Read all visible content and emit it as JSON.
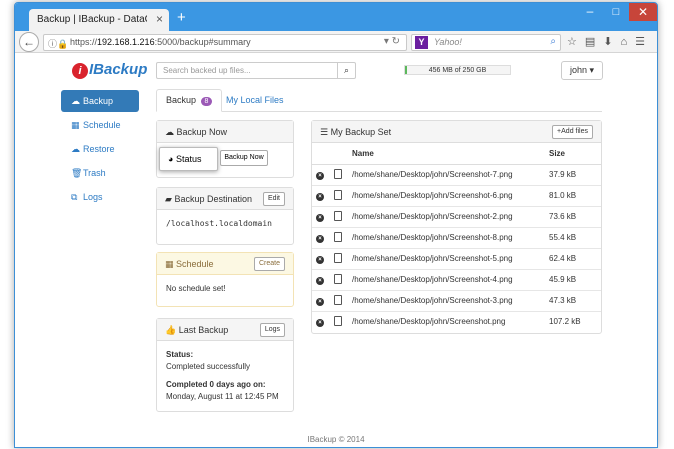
{
  "browser": {
    "tab_title": "Backup | IBackup - DataCenter ...",
    "tab_close": "×",
    "new_tab": "+",
    "url_prefix": "https://",
    "url_host": "192.168.1.216",
    "url_rest": ":5000/backup#summary",
    "search_placeholder": "Yahoo!",
    "window_buttons": {
      "minimize": "–",
      "maximize": "□",
      "close": "✕"
    }
  },
  "app": {
    "logo": "IBackup",
    "search_placeholder": "Search backed up files...",
    "storage": {
      "label": "456 MB of 250 GB",
      "used_fraction": 0.002
    },
    "user": "john"
  },
  "sidebar": {
    "items": [
      {
        "label": "Backup",
        "icon": "cloud-upload-icon",
        "active": true
      },
      {
        "label": "Schedule",
        "icon": "calendar-icon"
      },
      {
        "label": "Restore",
        "icon": "cloud-download-icon"
      },
      {
        "label": "Trash",
        "icon": "trash-icon"
      },
      {
        "label": "Logs",
        "icon": "logs-icon"
      }
    ]
  },
  "tabs": {
    "backup": "Backup",
    "backup_count": "8",
    "local_files": "My Local Files"
  },
  "backup_now": {
    "title": "Backup Now",
    "status_label": "Status",
    "button": "Backup Now"
  },
  "destination": {
    "title": "Backup Destination",
    "edit": "Edit",
    "value": "/localhost.localdomain"
  },
  "schedule": {
    "title": "Schedule",
    "create": "Create",
    "empty": "No schedule set!"
  },
  "last_backup": {
    "title": "Last Backup",
    "logs": "Logs",
    "status_label": "Status:",
    "status_value": "Completed successfully",
    "completed_label": "Completed 0 days ago on:",
    "completed_value": "Monday, August 11 at 12:45 PM"
  },
  "backup_set": {
    "title": "My Backup Set",
    "add_files": "Add files",
    "col_name": "Name",
    "col_size": "Size",
    "files": [
      {
        "name": "/home/shane/Desktop/john/Screenshot-7.png",
        "size": "37.9 kB"
      },
      {
        "name": "/home/shane/Desktop/john/Screenshot-6.png",
        "size": "81.0 kB"
      },
      {
        "name": "/home/shane/Desktop/john/Screenshot-2.png",
        "size": "73.6 kB"
      },
      {
        "name": "/home/shane/Desktop/john/Screenshot-8.png",
        "size": "55.4 kB"
      },
      {
        "name": "/home/shane/Desktop/john/Screenshot-5.png",
        "size": "62.4 kB"
      },
      {
        "name": "/home/shane/Desktop/john/Screenshot-4.png",
        "size": "45.9 kB"
      },
      {
        "name": "/home/shane/Desktop/john/Screenshot-3.png",
        "size": "47.3 kB"
      },
      {
        "name": "/home/shane/Desktop/john/Screenshot.png",
        "size": "107.2 kB"
      }
    ]
  },
  "footer": "IBackup © 2014"
}
